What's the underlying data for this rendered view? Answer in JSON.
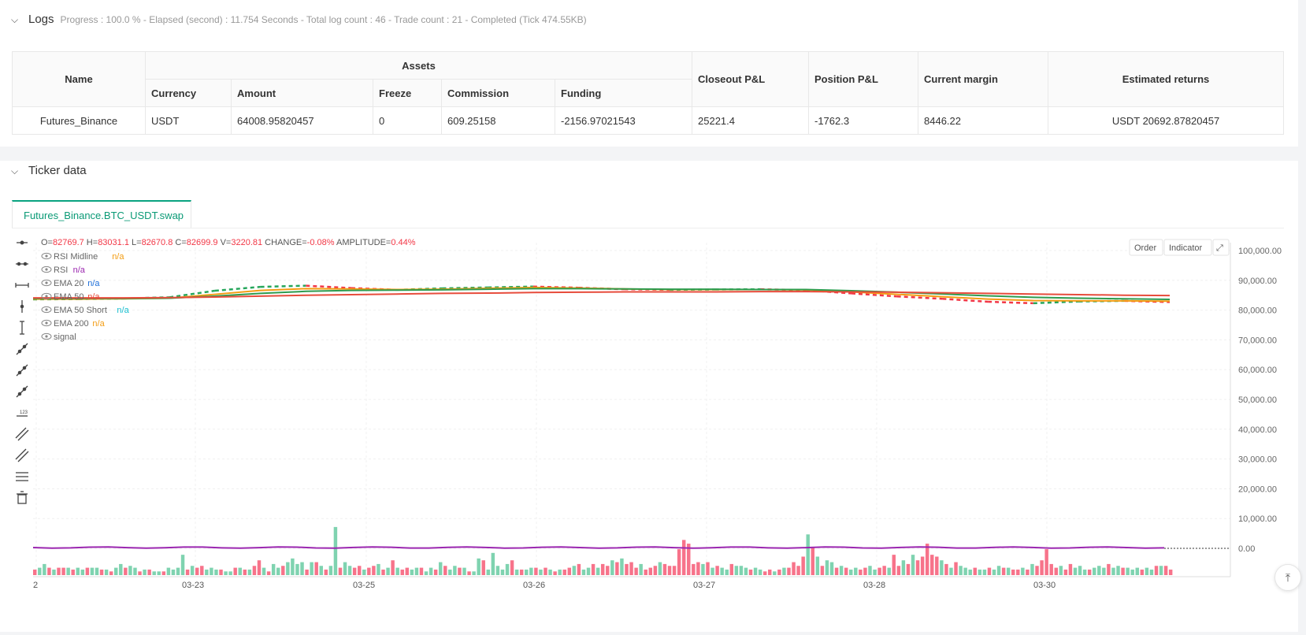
{
  "logs": {
    "title": "Logs",
    "progress_text": "Progress : 100.0 % - Elapsed (second) : 11.754  Seconds - Total log count : 46 - Trade count : 21 - Completed (Tick 474.55KB)"
  },
  "assets_table": {
    "headers": {
      "name": "Name",
      "assets": "Assets",
      "currency": "Currency",
      "amount": "Amount",
      "freeze": "Freeze",
      "commission": "Commission",
      "funding": "Funding",
      "closeout_pl": "Closeout P&L",
      "position_pl": "Position P&L",
      "current_margin": "Current margin",
      "estimated_returns": "Estimated returns"
    },
    "row": {
      "name": "Futures_Binance",
      "currency": "USDT",
      "amount": "64008.95820457",
      "freeze": "0",
      "commission": "609.25158",
      "funding": "-2156.97021543",
      "closeout_pl": "25221.4",
      "position_pl": "-1762.3",
      "current_margin": "8446.22",
      "estimated_returns": "USDT 20692.87820457"
    }
  },
  "ticker": {
    "title": "Ticker data",
    "tab_label": "Futures_Binance.BTC_USDT.swap"
  },
  "ohlc": {
    "o_label": "O=",
    "o": "82769.7",
    "h_label": "H=",
    "h": "83031.1",
    "l_label": "L=",
    "l": "82670.8",
    "c_label": "C=",
    "c": "82699.9",
    "v_label": "V=",
    "v": "3220.81",
    "change_label": "CHANGE=",
    "change": "-0.08%",
    "amp_label": "AMPLITUDE=",
    "amp": "0.44%"
  },
  "legend": [
    {
      "name": "RSI Midline",
      "value": "n/a",
      "value_color": "#f39c12"
    },
    {
      "name": "RSI",
      "value": "n/a",
      "value_color": "#9b27b0"
    },
    {
      "name": "EMA 20",
      "value": "n/a",
      "value_color": "#1e6fd9"
    },
    {
      "name": "EMA 50",
      "value": "n/a",
      "value_color": "#e74c3c"
    },
    {
      "name": "EMA 50 Short",
      "value": "n/a",
      "value_color": "#17becf"
    },
    {
      "name": "EMA 200",
      "value": "n/a",
      "value_color": "#f39c12"
    },
    {
      "name": "signal",
      "value": "",
      "value_color": "#999999"
    }
  ],
  "chart_buttons": {
    "order": "Order",
    "indicator": "Indicator"
  },
  "toolbar_icons": [
    "horizontal-ray-icon",
    "horizontal-line-icon",
    "horizontal-segment-icon",
    "vertical-line-icon",
    "vertical-segment-icon",
    "trend-line-icon",
    "ray-icon",
    "extended-line-icon",
    "price-label-icon",
    "parallel-channel-icon",
    "pitchfork-icon",
    "fib-retracement-icon",
    "trash-icon"
  ],
  "chart_data": {
    "type": "line",
    "x_ticks": [
      "2",
      "03-23",
      "03-25",
      "03-26",
      "03-27",
      "03-28",
      "03-30"
    ],
    "y_ticks": [
      "100,000.00",
      "90,000.00",
      "80,000.00",
      "70,000.00",
      "60,000.00",
      "50,000.00",
      "40,000.00",
      "30,000.00",
      "20,000.00",
      "10,000.00",
      "0.00"
    ],
    "ylim": [
      0,
      100000
    ],
    "colors": {
      "up": "#26a65b",
      "down": "#f23645",
      "vol_up": "#7fd3b0",
      "vol_down": "#f7738a",
      "ema_fast": "#2e9b4e",
      "ema_mid": "#f39c12",
      "ema_slow": "#e74c3c",
      "rsi": "#9b27b0"
    },
    "series": [
      {
        "values": [
          83600,
          83700,
          83900,
          84300,
          86500,
          87800,
          88200,
          87400,
          86800,
          87300,
          87600,
          87900,
          87500,
          87000,
          86800,
          86900,
          87000,
          86700,
          85600,
          84600,
          83800,
          82800,
          82300,
          82900,
          83100,
          82700
        ]
      },
      {
        "values": [
          83700,
          83700,
          83800,
          84000,
          85300,
          86600,
          87200,
          87100,
          86900,
          87000,
          87300,
          87600,
          87400,
          87100,
          86900,
          86900,
          86900,
          86800,
          86100,
          85300,
          84500,
          83700,
          83200,
          83100,
          83100,
          83000
        ]
      },
      {
        "values": [
          83900,
          83900,
          83900,
          84000,
          84700,
          85600,
          86300,
          86600,
          86700,
          86800,
          87000,
          87200,
          87200,
          87100,
          87000,
          87000,
          86900,
          86900,
          86500,
          86000,
          85400,
          84800,
          84300,
          84000,
          83800,
          83600
        ]
      },
      {
        "values": [
          84100,
          84100,
          84100,
          84200,
          84400,
          84700,
          85000,
          85200,
          85400,
          85600,
          85700,
          85900,
          86000,
          86100,
          86100,
          86100,
          86200,
          86200,
          86100,
          86000,
          85800,
          85600,
          85400,
          85200,
          85000,
          84900
        ]
      }
    ],
    "volume": [
      3,
      4,
      6,
      4,
      3,
      4,
      4,
      4,
      3,
      4,
      3,
      4,
      4,
      4,
      3,
      3,
      2,
      4,
      6,
      4,
      5,
      4,
      2,
      3,
      3,
      2,
      2,
      2,
      4,
      3,
      4,
      11,
      3,
      5,
      4,
      5,
      3,
      4,
      3,
      3,
      2,
      2,
      4,
      4,
      3,
      3,
      5,
      8,
      4,
      2,
      6,
      4,
      5,
      7,
      9,
      6,
      7,
      3,
      7,
      7,
      5,
      3,
      5,
      26,
      4,
      7,
      5,
      4,
      5,
      3,
      4,
      5,
      6,
      3,
      4,
      8,
      4,
      3,
      4,
      3,
      4,
      4,
      2,
      4,
      3,
      7,
      5,
      3,
      5,
      4,
      4,
      2,
      2,
      9,
      8,
      3,
      12,
      5,
      3,
      6,
      8,
      3,
      3,
      3,
      4,
      4,
      3,
      4,
      3,
      2,
      3,
      3,
      4,
      5,
      6,
      3,
      4,
      6,
      4,
      6,
      5,
      8,
      7,
      9,
      6,
      7,
      4,
      6,
      3,
      4,
      5,
      7,
      6,
      5,
      5,
      14,
      19,
      17,
      6,
      7,
      6,
      7,
      4,
      5,
      4,
      3,
      6,
      5,
      5,
      4,
      3,
      4,
      3,
      2,
      3,
      2,
      3,
      4,
      4,
      7,
      5,
      10,
      22,
      15,
      10,
      5,
      8,
      7,
      4,
      5,
      4,
      3,
      4,
      3,
      4,
      5,
      3,
      4,
      5,
      4,
      11,
      5,
      8,
      6,
      11,
      8,
      10,
      17,
      11,
      10,
      8,
      6,
      4,
      7,
      5,
      4,
      3,
      4,
      3,
      3,
      4,
      3,
      5,
      4,
      4,
      3,
      3,
      4,
      3,
      6,
      5,
      8,
      14,
      6,
      4,
      5,
      3,
      6,
      4,
      5,
      3,
      3,
      4,
      5,
      4,
      6,
      4,
      5,
      4,
      4,
      3,
      4,
      3,
      4,
      3,
      5,
      5,
      5,
      3
    ],
    "volume_up": [
      0,
      1,
      1,
      0,
      1,
      0,
      0,
      1,
      0,
      1,
      1,
      0,
      1,
      1,
      0,
      1,
      0,
      1,
      1,
      0,
      1,
      1,
      0,
      1,
      0,
      1,
      1,
      0,
      1,
      1,
      1,
      1,
      0,
      1,
      0,
      0,
      1,
      1,
      1,
      0,
      1,
      1,
      0,
      1,
      0,
      1,
      0,
      0,
      1,
      0,
      1,
      1,
      0,
      1,
      1,
      1,
      1,
      0,
      1,
      0,
      1,
      0,
      1,
      1,
      0,
      1,
      1,
      0,
      0,
      1,
      0,
      0,
      1,
      0,
      1,
      0,
      1,
      0,
      0,
      1,
      1,
      0,
      1,
      1,
      0,
      1,
      0,
      1,
      1,
      0,
      1,
      0,
      1,
      1,
      0,
      1,
      1,
      1,
      1,
      1,
      0,
      1,
      0,
      1,
      1,
      0,
      1,
      0,
      1,
      0,
      1,
      0,
      0,
      1,
      0,
      1,
      1,
      0,
      1,
      0,
      0,
      1,
      0,
      1,
      0,
      0,
      0,
      1,
      0,
      0,
      0,
      1,
      0,
      0,
      0,
      0,
      0,
      0,
      0,
      0,
      1,
      0,
      1,
      0,
      1,
      1,
      0,
      1,
      1,
      1,
      0,
      1,
      1,
      0,
      0,
      1,
      0,
      1,
      0,
      0,
      0,
      0,
      1,
      0,
      1,
      0,
      1,
      1,
      0,
      1,
      0,
      1,
      1,
      0,
      0,
      1,
      1,
      0,
      0,
      1,
      0,
      0,
      1,
      0,
      1,
      0,
      0,
      0,
      0,
      0,
      1,
      0,
      1,
      0,
      1,
      1,
      1,
      0,
      1,
      1,
      0,
      1,
      1,
      0,
      1,
      0,
      0,
      1,
      0,
      1,
      0,
      0,
      0,
      0,
      0,
      1,
      0,
      0,
      1,
      1,
      1,
      0,
      1,
      1,
      1,
      0,
      1,
      1,
      0,
      1,
      1,
      1,
      0,
      1,
      1,
      0,
      1,
      0,
      0,
      0
    ]
  }
}
